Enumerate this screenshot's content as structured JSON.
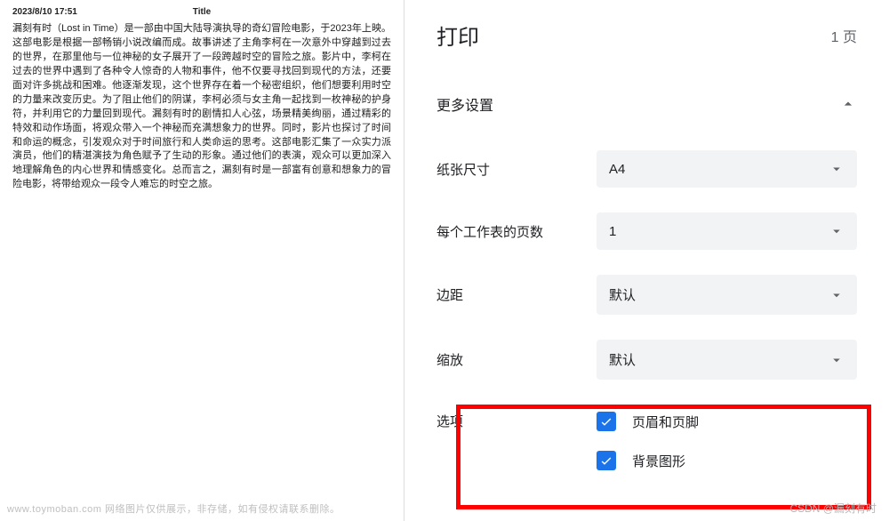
{
  "preview": {
    "timestamp": "2023/8/10 17:51",
    "title": "Title",
    "body": "漏刻有时（Lost in Time）是一部由中国大陆导演执导的奇幻冒险电影，于2023年上映。这部电影是根据一部畅销小说改编而成。故事讲述了主角李柯在一次意外中穿越到过去的世界，在那里他与一位神秘的女子展开了一段跨越时空的冒险之旅。影片中，李柯在过去的世界中遇到了各种令人惊奇的人物和事件，他不仅要寻找回到现代的方法，还要面对许多挑战和困难。他逐渐发现，这个世界存在着一个秘密组织，他们想要利用时空的力量来改变历史。为了阻止他们的阴谋，李柯必须与女主角一起找到一枚神秘的护身符，并利用它的力量回到现代。漏刻有时的剧情扣人心弦，场景精美绚丽，通过精彩的特效和动作场面，将观众带入一个神秘而充满想象力的世界。同时，影片也探讨了时间和命运的概念，引发观众对于时间旅行和人类命运的思考。这部电影汇集了一众实力派演员，他们的精湛演技为角色赋予了生动的形象。通过他们的表演，观众可以更加深入地理解角色的内心世界和情感变化。总而言之，漏刻有时是一部富有创意和想象力的冒险电影，将带给观众一段令人难忘的时空之旅。"
  },
  "panel": {
    "title": "打印",
    "page_count": "1 页",
    "more_settings": "更多设置",
    "paper_size": {
      "label": "纸张尺寸",
      "value": "A4"
    },
    "pages_per_sheet": {
      "label": "每个工作表的页数",
      "value": "1"
    },
    "margins": {
      "label": "边距",
      "value": "默认"
    },
    "scale": {
      "label": "缩放",
      "value": "默认"
    },
    "options": {
      "label": "选项",
      "headers_footers": "页眉和页脚",
      "background_graphics": "背景图形"
    }
  },
  "footer": {
    "left": "www.toymoban.com 网络图片仅供展示，非存储，如有侵权请联系删除。",
    "right": "CSDN @漏刻有时"
  }
}
